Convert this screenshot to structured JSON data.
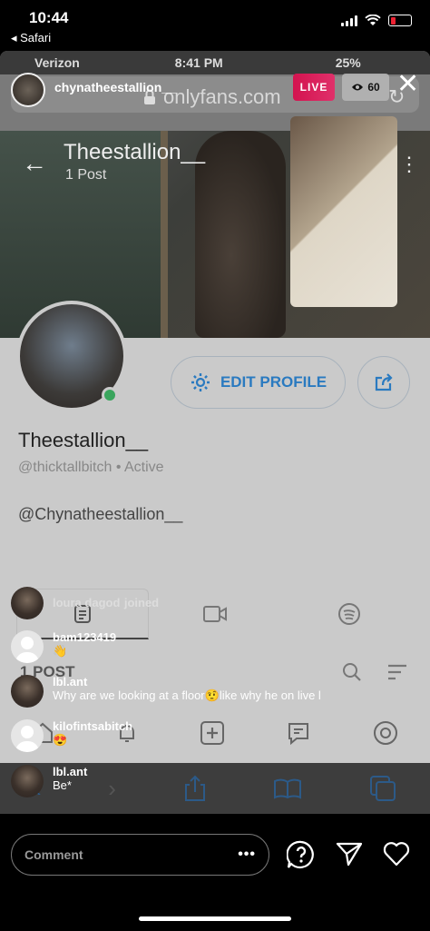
{
  "ios_status": {
    "time": "10:44",
    "back_label": "Safari"
  },
  "inner_status": {
    "carrier": "Verizon",
    "time": "8:41 PM",
    "battery": "25%"
  },
  "browser": {
    "url": "onlyfans.com"
  },
  "profile": {
    "name": "Theestallion__",
    "post_count": "1 Post",
    "display_name": "Theestallion__",
    "handle": "@thicktallbitch",
    "status": "Active",
    "bio_mention": "@Chynatheestallion__",
    "edit_label": "EDIT PROFILE",
    "posts_header": "1 POST"
  },
  "live": {
    "username": "chynatheestallion__",
    "badge": "LIVE",
    "viewers": "60"
  },
  "comments": [
    {
      "user": "loura dagod",
      "text": "joined"
    },
    {
      "user": "bam123419",
      "text": "👋"
    },
    {
      "user": "lbl.ant",
      "text": "Why are we looking at a floor🤨like why he on live l"
    },
    {
      "user": "kilofintsabitch",
      "text": "😍"
    },
    {
      "user": "lbl.ant",
      "text": "Be*"
    }
  ],
  "comment_bar": {
    "placeholder": "Comment",
    "more": "•••"
  },
  "colors": {
    "live": "#d3134f",
    "accent": "#2a7ac0",
    "online": "#3aa55d"
  }
}
